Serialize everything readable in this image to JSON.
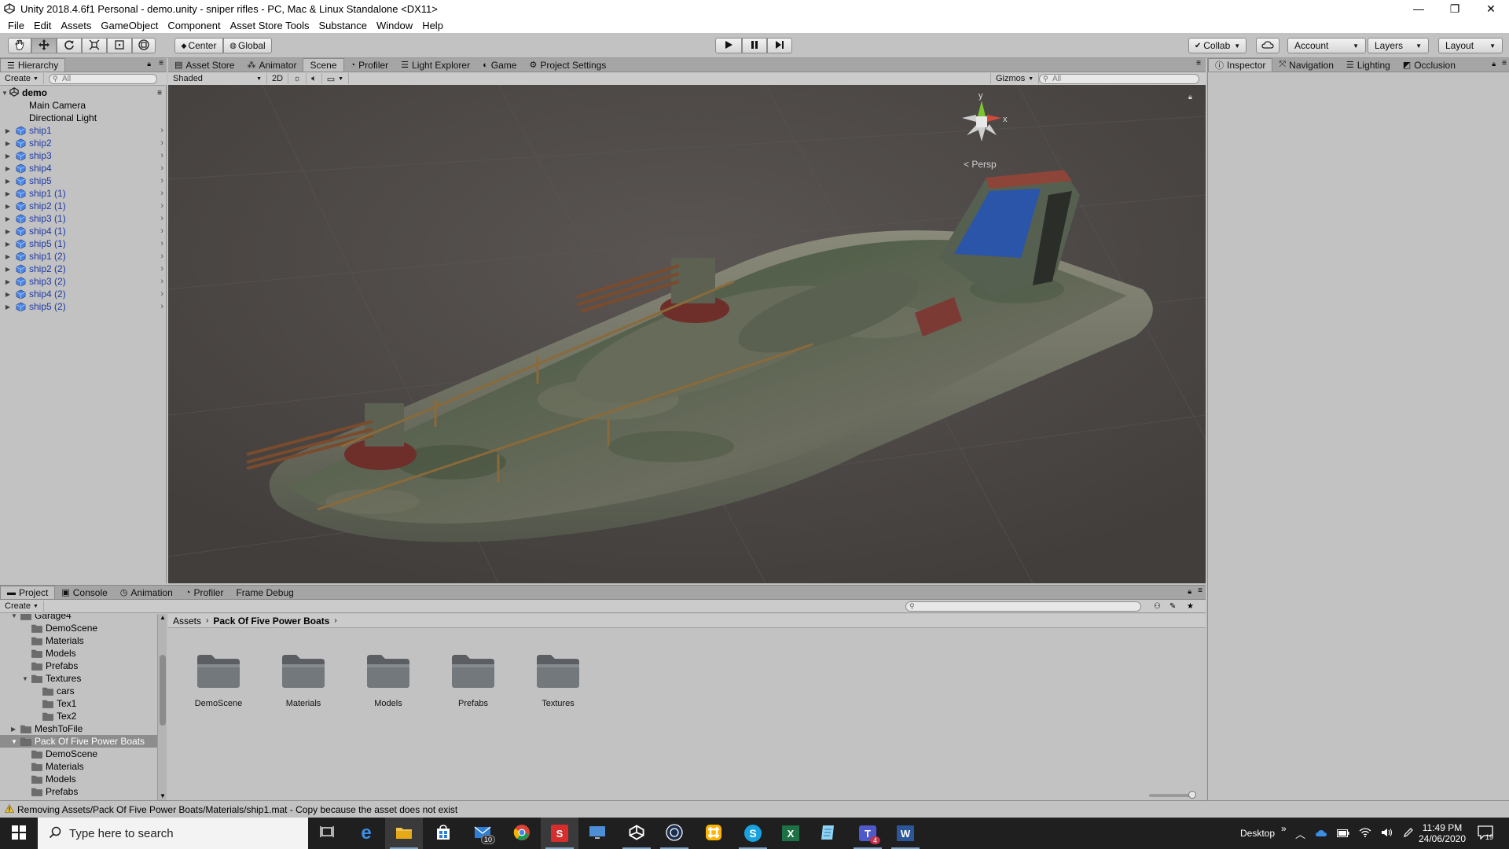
{
  "window": {
    "title": "Unity 2018.4.6f1 Personal - demo.unity - sniper rifles - PC, Mac & Linux Standalone <DX11>",
    "minimize": "—",
    "restore": "❐",
    "close": "✕"
  },
  "menu": [
    "File",
    "Edit",
    "Assets",
    "GameObject",
    "Component",
    "Asset Store Tools",
    "Substance",
    "Window",
    "Help"
  ],
  "toolbar": {
    "pivot_label": "Center",
    "space_label": "Global",
    "collab_label": "Collab",
    "account_label": "Account",
    "layers_label": "Layers",
    "layout_label": "Layout"
  },
  "hierarchy": {
    "tab_label": "Hierarchy",
    "create_label": "Create",
    "search_placeholder": "All",
    "scene_name": "demo",
    "items": [
      {
        "label": "Main Camera",
        "prefab": false
      },
      {
        "label": "Directional Light",
        "prefab": false
      },
      {
        "label": "ship1",
        "prefab": true
      },
      {
        "label": "ship2",
        "prefab": true
      },
      {
        "label": "ship3",
        "prefab": true
      },
      {
        "label": "ship4",
        "prefab": true
      },
      {
        "label": "ship5",
        "prefab": true
      },
      {
        "label": "ship1 (1)",
        "prefab": true
      },
      {
        "label": "ship2 (1)",
        "prefab": true
      },
      {
        "label": "ship3 (1)",
        "prefab": true
      },
      {
        "label": "ship4 (1)",
        "prefab": true
      },
      {
        "label": "ship5 (1)",
        "prefab": true
      },
      {
        "label": "ship1 (2)",
        "prefab": true
      },
      {
        "label": "ship2 (2)",
        "prefab": true
      },
      {
        "label": "ship3 (2)",
        "prefab": true
      },
      {
        "label": "ship4 (2)",
        "prefab": true
      },
      {
        "label": "ship5 (2)",
        "prefab": true
      }
    ]
  },
  "scene_tabs": [
    {
      "label": "Asset Store",
      "icon": "store-icon"
    },
    {
      "label": "Animator",
      "icon": "animator-icon"
    },
    {
      "label": "Scene",
      "icon": "",
      "active": true
    },
    {
      "label": "Profiler",
      "icon": "profiler-icon"
    },
    {
      "label": "Light Explorer",
      "icon": "light-explorer-icon"
    },
    {
      "label": "Game",
      "icon": "game-icon"
    },
    {
      "label": "Project Settings",
      "icon": "gear-icon"
    }
  ],
  "scene_toolbar": {
    "shading_mode": "Shaded",
    "mode_2d": "2D",
    "gizmos_label": "Gizmos",
    "search_placeholder": "All",
    "persp_label": "< Persp",
    "axis_y": "y",
    "axis_x": "x"
  },
  "inspector_tabs": [
    {
      "label": "Inspector",
      "active": true
    },
    {
      "label": "Navigation",
      "active": false
    },
    {
      "label": "Lighting",
      "active": false
    },
    {
      "label": "Occlusion",
      "active": false
    }
  ],
  "project_tabs": [
    {
      "label": "Project",
      "active": true
    },
    {
      "label": "Console",
      "active": false
    },
    {
      "label": "Animation",
      "active": false
    },
    {
      "label": "Profiler",
      "active": false
    },
    {
      "label": "Frame Debug",
      "active": false
    }
  ],
  "project": {
    "create_label": "Create",
    "breadcrumb": [
      "Assets",
      "Pack Of Five Power Boats"
    ],
    "tree": [
      {
        "label": "Garage4",
        "depth": 1,
        "expand": "open"
      },
      {
        "label": "DemoScene",
        "depth": 2,
        "expand": ""
      },
      {
        "label": "Materials",
        "depth": 2,
        "expand": ""
      },
      {
        "label": "Models",
        "depth": 2,
        "expand": ""
      },
      {
        "label": "Prefabs",
        "depth": 2,
        "expand": ""
      },
      {
        "label": "Textures",
        "depth": 2,
        "expand": "open"
      },
      {
        "label": "cars",
        "depth": 3,
        "expand": ""
      },
      {
        "label": "Tex1",
        "depth": 3,
        "expand": ""
      },
      {
        "label": "Tex2",
        "depth": 3,
        "expand": ""
      },
      {
        "label": "MeshToFile",
        "depth": 1,
        "expand": "closed"
      },
      {
        "label": "Pack Of Five Power Boats",
        "depth": 1,
        "expand": "open",
        "selected": true
      },
      {
        "label": "DemoScene",
        "depth": 2,
        "expand": ""
      },
      {
        "label": "Materials",
        "depth": 2,
        "expand": ""
      },
      {
        "label": "Models",
        "depth": 2,
        "expand": ""
      },
      {
        "label": "Prefabs",
        "depth": 2,
        "expand": ""
      }
    ],
    "folders": [
      "DemoScene",
      "Materials",
      "Models",
      "Prefabs",
      "Textures"
    ]
  },
  "status": {
    "message": "Removing Assets/Pack Of Five Power Boats/Materials/ship1.mat - Copy because the asset does not exist"
  },
  "taskbar": {
    "search_placeholder": "Type here to search",
    "desktop_label": "Desktop",
    "chevron": "»",
    "time": "11:49 PM",
    "date": "24/06/2020",
    "mail_badge": "10",
    "teams_badge": "4",
    "notif_count": "19"
  },
  "colors": {
    "unity_bg": "#c2c2c2",
    "viewport_bg": "#4e4a48",
    "prefab_text": "#1f3aa6",
    "taskbar_bg": "#1f1f1f"
  }
}
